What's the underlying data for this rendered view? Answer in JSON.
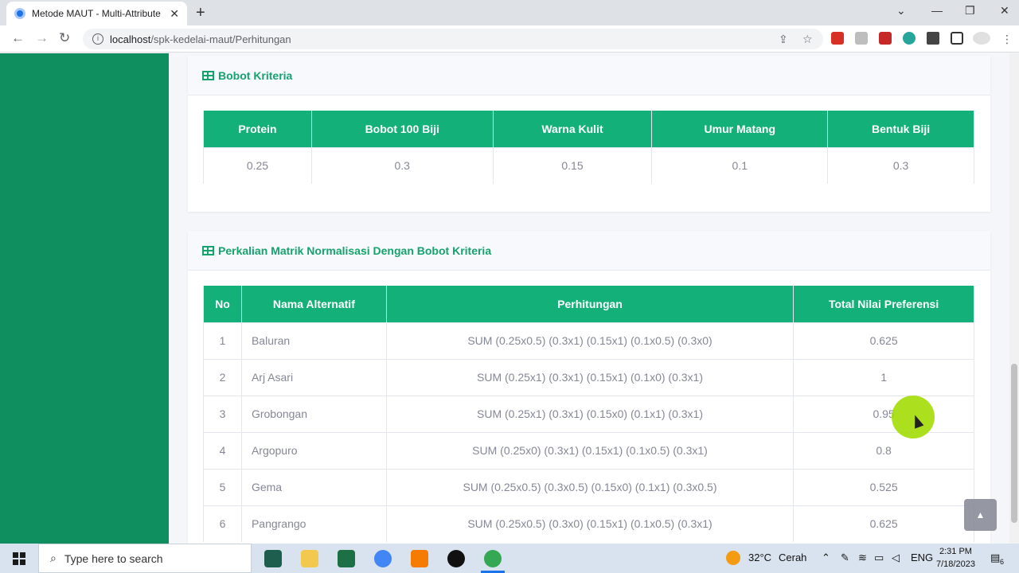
{
  "browser": {
    "tab_title": "Metode MAUT - Multi-Attribute",
    "tab_close": "✕",
    "new_tab": "+",
    "url_host": "localhost",
    "url_path": "/spk-kedelai-maut/Perhitungan"
  },
  "bobot_card": {
    "title": "Bobot Kriteria",
    "headers": [
      "Protein",
      "Bobot 100 Biji",
      "Warna Kulit",
      "Umur Matang",
      "Bentuk Biji"
    ],
    "values": [
      "0.25",
      "0.3",
      "0.15",
      "0.1",
      "0.3"
    ]
  },
  "perkalian_card": {
    "title": "Perkalian Matrik Normalisasi Dengan Bobot Kriteria",
    "headers": [
      "No",
      "Nama Alternatif",
      "Perhitungan",
      "Total Nilai Preferensi"
    ],
    "rows": [
      {
        "no": "1",
        "nama": "Baluran",
        "perhitungan": "SUM (0.25x0.5) (0.3x1) (0.15x1) (0.1x0.5) (0.3x0)",
        "total": "0.625"
      },
      {
        "no": "2",
        "nama": "Arj Asari",
        "perhitungan": "SUM (0.25x1) (0.3x1) (0.15x1) (0.1x0) (0.3x1)",
        "total": "1"
      },
      {
        "no": "3",
        "nama": "Grobongan",
        "perhitungan": "SUM (0.25x1) (0.3x1) (0.15x0) (0.1x1) (0.3x1)",
        "total": "0.95"
      },
      {
        "no": "4",
        "nama": "Argopuro",
        "perhitungan": "SUM (0.25x0) (0.3x1) (0.15x1) (0.1x0.5) (0.3x1)",
        "total": "0.8"
      },
      {
        "no": "5",
        "nama": "Gema",
        "perhitungan": "SUM (0.25x0.5) (0.3x0.5) (0.15x0) (0.1x1) (0.3x0.5)",
        "total": "0.525"
      },
      {
        "no": "6",
        "nama": "Pangrango",
        "perhitungan": "SUM (0.25x0.5) (0.3x0) (0.15x1) (0.1x0.5) (0.3x1)",
        "total": "0.625"
      }
    ]
  },
  "taskbar": {
    "search_placeholder": "Type here to search",
    "weather_temp": "32°C",
    "weather_desc": "Cerah",
    "lang": "ENG",
    "time": "2:31 PM",
    "date": "7/18/2023",
    "notif_count": "6"
  },
  "colors": {
    "primary": "#14b07a",
    "sidebar": "#0f8f60",
    "text_muted": "#858796"
  }
}
